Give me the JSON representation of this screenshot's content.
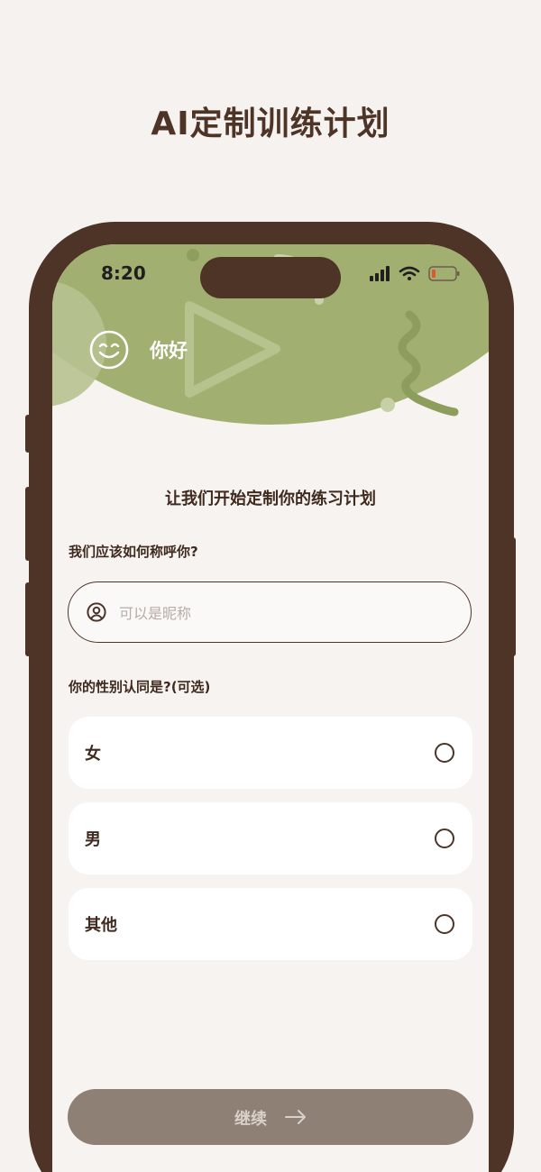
{
  "page": {
    "heading": "AI定制训练计划"
  },
  "status_bar": {
    "time": "8:20",
    "icons": [
      "signal-icon",
      "wifi-icon",
      "battery-icon"
    ]
  },
  "header": {
    "avatar_icon": "smiley-icon",
    "greeting": "你好",
    "accent_color": "#a1b070"
  },
  "form": {
    "title": "让我们开始定制你的练习计划",
    "name_question": "我们应该如何称呼你?",
    "name_input": {
      "placeholder": "可以是昵称",
      "value": ""
    },
    "gender_question": "你的性别认同是?(可选)",
    "gender_options": [
      {
        "label": "女",
        "selected": false
      },
      {
        "label": "男",
        "selected": false
      },
      {
        "label": "其他",
        "selected": false
      }
    ]
  },
  "footer": {
    "continue_label": "继续",
    "arrow_icon": "arrow-right-icon",
    "button_color": "#8f8076"
  },
  "colors": {
    "brown": "#4d3427",
    "background": "#f7f3f1"
  }
}
